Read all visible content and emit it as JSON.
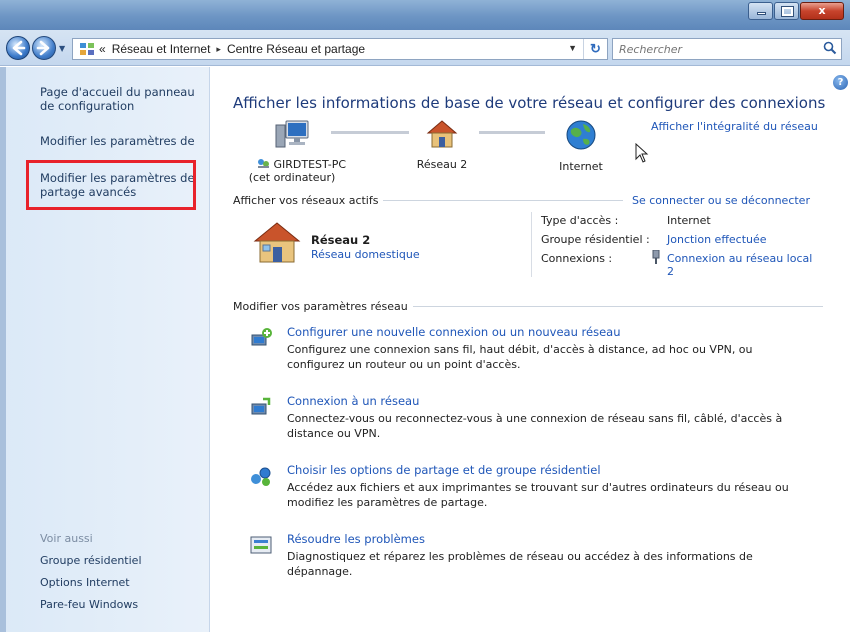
{
  "window": {
    "close_glyph": "x"
  },
  "address_bar": {
    "crumbs": [
      "«",
      "Réseau et Internet",
      "Centre Réseau et partage"
    ],
    "separator": "▸",
    "refresh_glyph": "↻"
  },
  "search": {
    "placeholder": "Rechercher"
  },
  "sidebar": {
    "links": [
      "Page d'accueil du panneau de configuration",
      "Modifier les paramètres de la carte",
      "Modifier les paramètres de partage avancés"
    ],
    "see_also_label": "Voir aussi",
    "see_also": [
      "Groupe résidentiel",
      "Options Internet",
      "Pare-feu Windows"
    ]
  },
  "main": {
    "help_glyph": "?",
    "title": "Afficher les informations de base de votre réseau et configurer des connexions",
    "full_map_link": "Afficher l'intégralité du réseau",
    "map": {
      "computer_name": "GIRDTEST-PC",
      "computer_sub": "(cet ordinateur)",
      "network": "Réseau 2",
      "internet": "Internet"
    },
    "active_networks": {
      "heading": "Afficher vos réseaux actifs",
      "connect_link": "Se connecter ou se déconnecter",
      "network_name": "Réseau 2",
      "network_type": "Réseau domestique",
      "access_type_label": "Type d'accès :",
      "access_type_value": "Internet",
      "homegroup_label": "Groupe résidentiel :",
      "homegroup_value": "Jonction effectuée",
      "connections_label": "Connexions :",
      "connections_value": "Connexion au réseau local 2"
    },
    "change_settings": {
      "heading": "Modifier vos paramètres réseau",
      "tasks": [
        {
          "link": "Configurer une nouvelle connexion ou un nouveau réseau",
          "desc": "Configurez une connexion sans fil, haut débit, d'accès à distance, ad hoc ou VPN, ou configurez un routeur ou un point d'accès.",
          "icon": "new-connection-icon"
        },
        {
          "link": "Connexion à un réseau",
          "desc": "Connectez-vous ou reconnectez-vous à une connexion de réseau sans fil, câblé, d'accès à distance ou VPN.",
          "icon": "connect-network-icon"
        },
        {
          "link": "Choisir les options de partage et de groupe résidentiel",
          "desc": "Accédez aux fichiers et aux imprimantes se trouvant sur d'autres ordinateurs du réseau ou modifiez les paramètres de partage.",
          "icon": "sharing-options-icon"
        },
        {
          "link": "Résoudre les problèmes",
          "desc": "Diagnostiquez et réparez les problèmes de réseau ou accédez à des informations de dépannage.",
          "icon": "troubleshoot-icon"
        }
      ]
    }
  },
  "colors": {
    "link": "#1f56b8",
    "title": "#1e3b7b",
    "highlight": "#e8222b"
  }
}
